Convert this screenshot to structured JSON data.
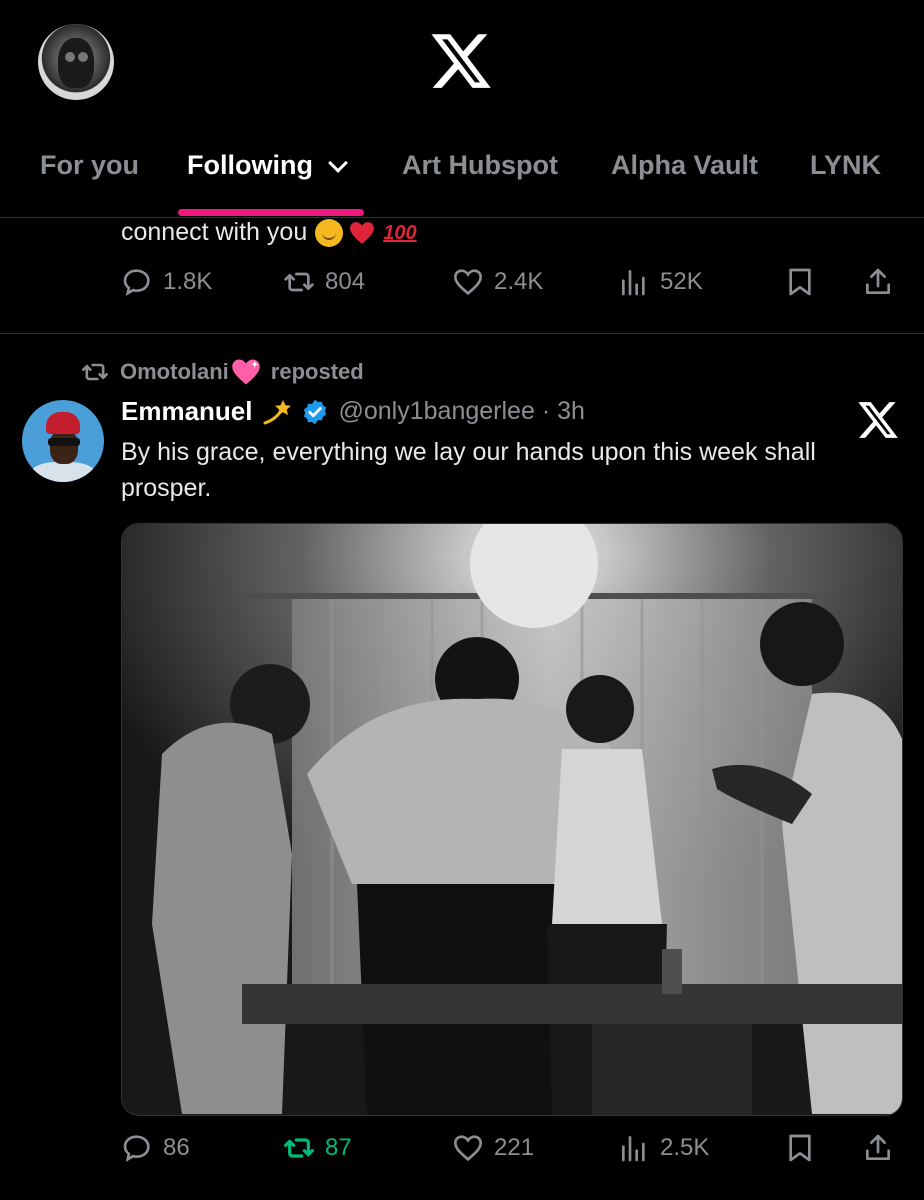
{
  "header": {
    "logo": "x-logo",
    "tabs": [
      {
        "label": "For you"
      },
      {
        "label": "Following"
      },
      {
        "label": "Art Hubspot"
      },
      {
        "label": "Alpha Vault"
      },
      {
        "label": "LYNK"
      }
    ]
  },
  "tweet1": {
    "text": "connect with you",
    "emoji": [
      "hugging-face",
      "red-heart",
      "hundred-points"
    ],
    "actions": {
      "replies": "1.8K",
      "reposts": "804",
      "likes": "2.4K",
      "views": "52K"
    }
  },
  "tweet2": {
    "repost_by": "Omotolani",
    "repost_label": "reposted",
    "author_name": "Emmanuel",
    "handle": "@only1bangerlee",
    "time_sep": "·",
    "time": "3h",
    "text": "By his grace, everything we lay our hands upon this week shall prosper.",
    "media_alt": "Black and white photo of men praying around a table",
    "actions": {
      "replies": "86",
      "reposts": "87",
      "likes": "221",
      "views": "2.5K"
    }
  },
  "colors": {
    "background": "#000000",
    "accent_underline": "#f0197d",
    "muted": "#8b8f94",
    "repost_active": "#00ba7c",
    "verified": "#1d9bf0"
  }
}
